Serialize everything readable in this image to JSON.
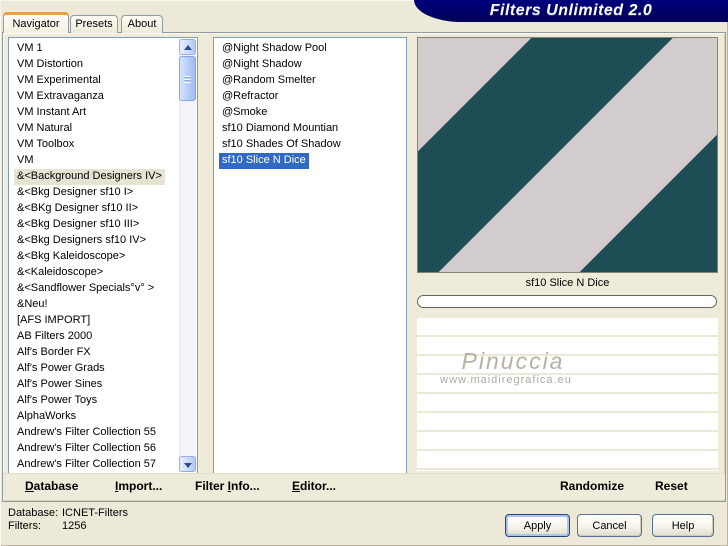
{
  "window": {
    "title": "Filters Unlimited 2.0"
  },
  "tabs": [
    {
      "label": "Navigator"
    },
    {
      "label": "Presets"
    },
    {
      "label": "About"
    }
  ],
  "active_tab": "Navigator",
  "category_list": {
    "selected": "&<Background Designers IV>",
    "items": [
      "VM 1",
      "VM Distortion",
      "VM Experimental",
      "VM Extravaganza",
      "VM Instant Art",
      "VM Natural",
      "VM Toolbox",
      "VM",
      "&<Background Designers IV>",
      "&<Bkg Designer sf10 I>",
      "&<BKg Designer sf10 II>",
      "&<Bkg Designer sf10 III>",
      "&<Bkg Designers sf10 IV>",
      "&<Bkg Kaleidoscope>",
      "&<Kaleidoscope>",
      "&<Sandflower Specials°v° >",
      "&Neu!",
      "[AFS IMPORT]",
      "AB Filters 2000",
      "Alf's Border FX",
      "Alf's Power Grads",
      "Alf's Power Sines",
      "Alf's Power Toys",
      "AlphaWorks",
      "Andrew's Filter Collection 55",
      "Andrew's Filter Collection 56",
      "Andrew's Filter Collection 57"
    ]
  },
  "filter_list": {
    "selected": "sf10 Slice N Dice",
    "items": [
      "@Night Shadow Pool",
      "@Night Shadow",
      "@Random Smelter",
      "@Refractor",
      "@Smoke",
      "sf10 Diamond Mountian",
      "sf10 Shades Of Shadow",
      "sf10 Slice N Dice"
    ]
  },
  "preview": {
    "caption": "sf10 Slice N Dice",
    "stripe_dark": "#1e4d55",
    "stripe_light": "#d3ccce"
  },
  "watermark": {
    "line1": "Pinuccia",
    "line2": "www.maidiregrafica.eu"
  },
  "command_bar": {
    "items": [
      {
        "pre": "",
        "key": "D",
        "rest": "atabase"
      },
      {
        "pre": "",
        "key": "I",
        "rest": "mport..."
      },
      {
        "pre": "Filter ",
        "key": "I",
        "rest": "nfo..."
      },
      {
        "pre": "",
        "key": "E",
        "rest": "ditor..."
      }
    ],
    "randomize": "Randomize",
    "reset": "Reset"
  },
  "status": {
    "rows": [
      {
        "label": "Database:",
        "value": "ICNET-Filters"
      },
      {
        "label": "Filters:",
        "value": "1256"
      }
    ]
  },
  "dialog_buttons": {
    "apply": "Apply",
    "cancel": "Cancel",
    "help": "Help"
  }
}
